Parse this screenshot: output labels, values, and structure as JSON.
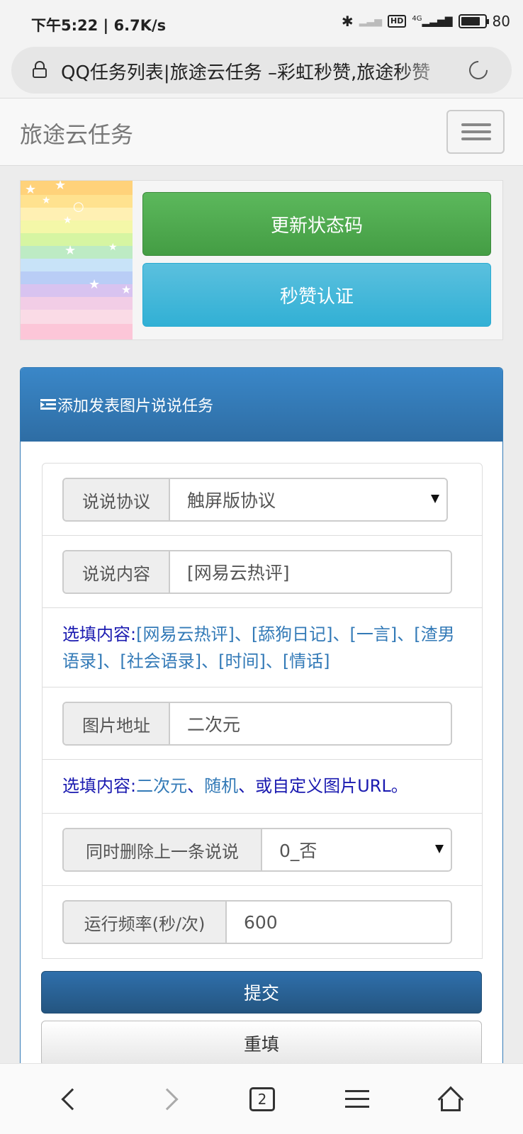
{
  "status_bar": {
    "time": "下午5:22",
    "speed": "6.7K/s",
    "hd_label": "HD",
    "network_label": "4G",
    "battery_percent": "80"
  },
  "browser": {
    "url_title": "QQ任务列表|旅途云任务 –彩虹秒赞,旅途秒赞"
  },
  "navbar": {
    "brand": "旅途云任务"
  },
  "top_actions": {
    "update_button": "更新状态码",
    "verify_button": "秒赞认证"
  },
  "panel": {
    "heading": "添加发表图片说说任务",
    "protocol": {
      "label": "说说协议",
      "value": "触屏版协议"
    },
    "content": {
      "label": "说说内容",
      "value": "[网易云热评]"
    },
    "content_hint": {
      "label": "选填内容:",
      "options": "[网易云热评]、[舔狗日记]、[一言]、[渣男语录]、[社会语录]、[时间]、[情话]"
    },
    "image": {
      "label": "图片地址",
      "value": "二次元"
    },
    "image_hint": {
      "label": "选填内容:",
      "option1": "二次元",
      "sep1": "、",
      "option2": "随机",
      "rest": "、或自定义图片URL。"
    },
    "delete_prev": {
      "label": "同时删除上一条说说",
      "value": "0_否"
    },
    "frequency": {
      "label": "运行频率(秒/次)",
      "value": "600"
    },
    "submit_button": "提交",
    "reset_button": "重填"
  },
  "bottom_nav": {
    "tab_count": "2"
  },
  "colors": {
    "primary": "#337ab7",
    "success": "#5cb85c",
    "info": "#5bc0de"
  }
}
